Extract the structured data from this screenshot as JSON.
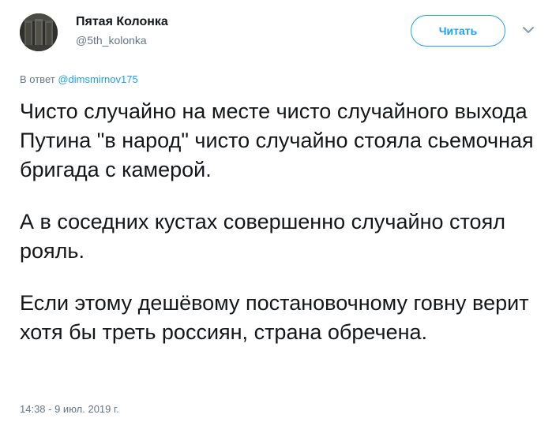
{
  "author": {
    "display_name": "Пятая Колонка",
    "handle": "@5th_kolonka",
    "avatar_icon": "avatar-image"
  },
  "follow_button": {
    "label": "Читать",
    "color": "#1da1f2"
  },
  "menu": {
    "icon": "chevron-down-icon"
  },
  "reply": {
    "prefix": "В ответ",
    "mention": "@dimsmirnov175"
  },
  "tweet": {
    "paragraphs": [
      "Чисто случайно на месте чисто случайного выхода Путина \"в народ\" чисто случайно стояла сьемочная бригада с камерой.",
      "А в соседних кустах совершенно случайно стоял рояль.",
      "Если этому дешёвому постановочному говну верит хотя бы треть россиян, страна обречена."
    ]
  },
  "timestamp": "14:38 - 9 июл. 2019 г."
}
